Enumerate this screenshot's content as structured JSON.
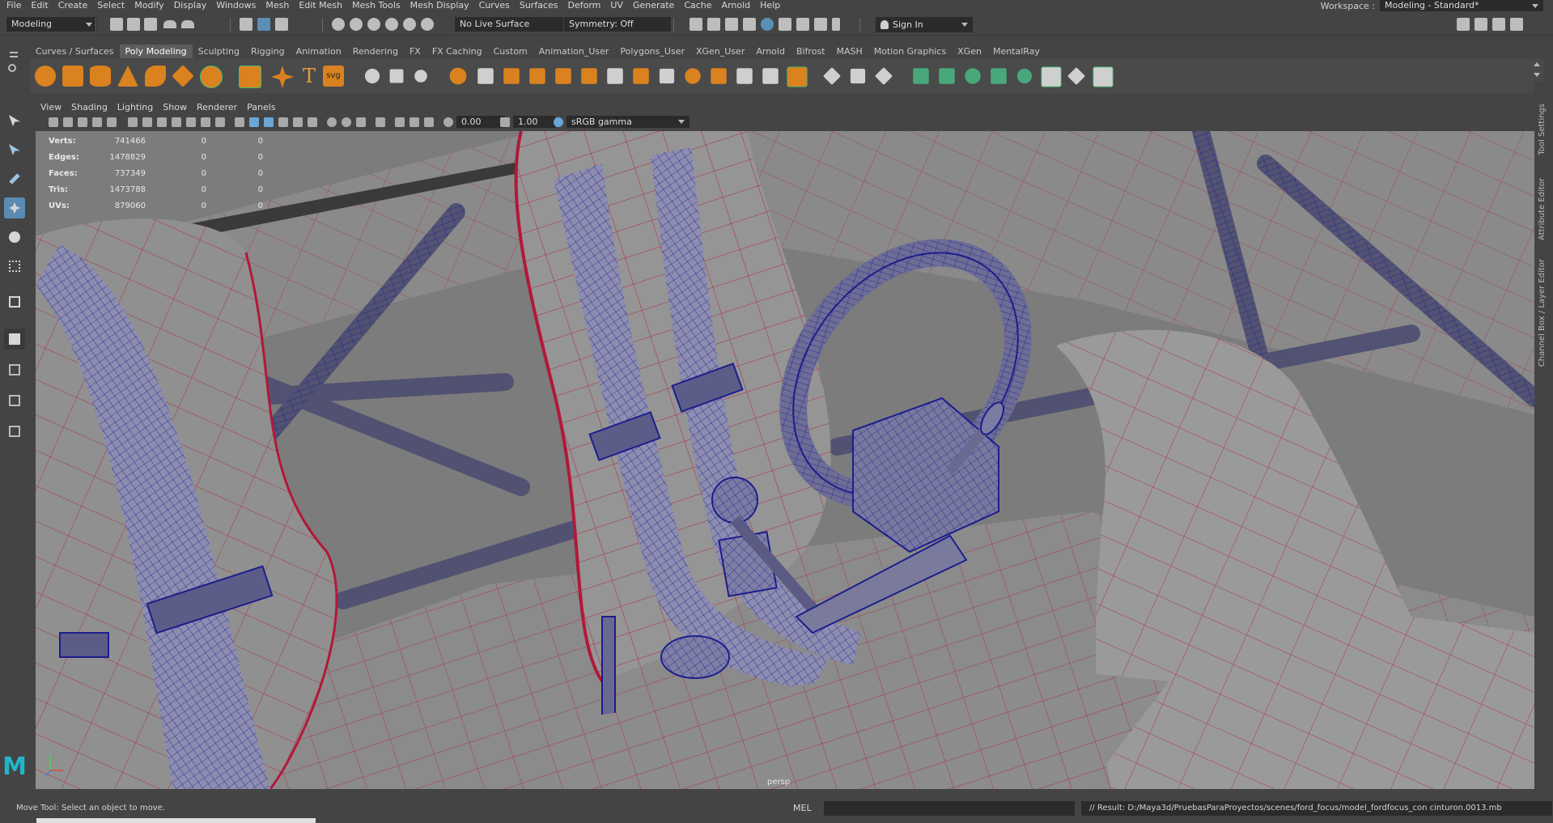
{
  "menubar": {
    "items": [
      "File",
      "Edit",
      "Create",
      "Select",
      "Modify",
      "Display",
      "Windows",
      "Mesh",
      "Edit Mesh",
      "Mesh Tools",
      "Mesh Display",
      "Curves",
      "Surfaces",
      "Deform",
      "UV",
      "Generate",
      "Cache",
      "Arnold",
      "Help"
    ],
    "workspace_label": "Workspace :",
    "workspace_value": "Modeling - Standard*"
  },
  "statusline": {
    "mode": "Modeling",
    "live_surface": "No Live Surface",
    "symmetry": "Symmetry: Off",
    "sign_in": "Sign In"
  },
  "shelf": {
    "tabs": [
      "Curves / Surfaces",
      "Poly Modeling",
      "Sculpting",
      "Rigging",
      "Animation",
      "Rendering",
      "FX",
      "FX Caching",
      "Custom",
      "Animation_User",
      "Polygons_User",
      "XGen_User",
      "Arnold",
      "Bifrost",
      "MASH",
      "Motion Graphics",
      "XGen",
      "MentalRay"
    ],
    "active_tab": "Poly Modeling",
    "svg_label": "svg",
    "text_label": "T"
  },
  "panel": {
    "menus": [
      "View",
      "Shading",
      "Lighting",
      "Show",
      "Renderer",
      "Panels"
    ],
    "exposure": "0.00",
    "gamma": "1.00",
    "color_space": "sRGB gamma",
    "camera": "persp"
  },
  "hud": {
    "rows": [
      {
        "label": "Verts:",
        "a": "741466",
        "b": "0",
        "c": "0"
      },
      {
        "label": "Edges:",
        "a": "1478829",
        "b": "0",
        "c": "0"
      },
      {
        "label": "Faces:",
        "a": "737349",
        "b": "0",
        "c": "0"
      },
      {
        "label": "Tris:",
        "a": "1473788",
        "b": "0",
        "c": "0"
      },
      {
        "label": "UVs:",
        "a": "879060",
        "b": "0",
        "c": "0"
      }
    ]
  },
  "sidebar_tabs": [
    "Tool Settings",
    "Attribute Editor",
    "Channel Box / Layer Editor"
  ],
  "bottom": {
    "help": "Move Tool: Select an object to move.",
    "mel": "MEL",
    "result": "// Result: D:/Maya3d/PruebasParaProyectos/scenes/ford_focus/model_fordfocus_con cinturon.0013.mb"
  },
  "logo": "M",
  "colors": {
    "accent": "#5b8bb3",
    "shelf_orange": "#d9821f",
    "wire_red": "#b2183a",
    "wire_blue": "#1c1e8c"
  }
}
